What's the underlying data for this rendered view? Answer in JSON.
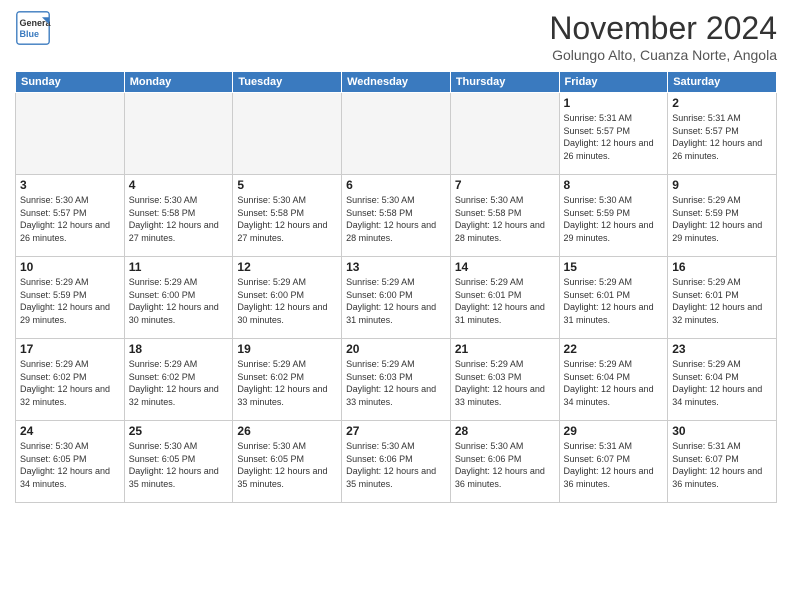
{
  "header": {
    "logo_general": "General",
    "logo_blue": "Blue",
    "month_title": "November 2024",
    "location": "Golungo Alto, Cuanza Norte, Angola"
  },
  "weekdays": [
    "Sunday",
    "Monday",
    "Tuesday",
    "Wednesday",
    "Thursday",
    "Friday",
    "Saturday"
  ],
  "weeks": [
    [
      {
        "day": "",
        "empty": true
      },
      {
        "day": "",
        "empty": true
      },
      {
        "day": "",
        "empty": true
      },
      {
        "day": "",
        "empty": true
      },
      {
        "day": "",
        "empty": true
      },
      {
        "day": "1",
        "info": "Sunrise: 5:31 AM\nSunset: 5:57 PM\nDaylight: 12 hours\nand 26 minutes."
      },
      {
        "day": "2",
        "info": "Sunrise: 5:31 AM\nSunset: 5:57 PM\nDaylight: 12 hours\nand 26 minutes."
      }
    ],
    [
      {
        "day": "3",
        "info": "Sunrise: 5:30 AM\nSunset: 5:57 PM\nDaylight: 12 hours\nand 26 minutes."
      },
      {
        "day": "4",
        "info": "Sunrise: 5:30 AM\nSunset: 5:58 PM\nDaylight: 12 hours\nand 27 minutes."
      },
      {
        "day": "5",
        "info": "Sunrise: 5:30 AM\nSunset: 5:58 PM\nDaylight: 12 hours\nand 27 minutes."
      },
      {
        "day": "6",
        "info": "Sunrise: 5:30 AM\nSunset: 5:58 PM\nDaylight: 12 hours\nand 28 minutes."
      },
      {
        "day": "7",
        "info": "Sunrise: 5:30 AM\nSunset: 5:58 PM\nDaylight: 12 hours\nand 28 minutes."
      },
      {
        "day": "8",
        "info": "Sunrise: 5:30 AM\nSunset: 5:59 PM\nDaylight: 12 hours\nand 29 minutes."
      },
      {
        "day": "9",
        "info": "Sunrise: 5:29 AM\nSunset: 5:59 PM\nDaylight: 12 hours\nand 29 minutes."
      }
    ],
    [
      {
        "day": "10",
        "info": "Sunrise: 5:29 AM\nSunset: 5:59 PM\nDaylight: 12 hours\nand 29 minutes."
      },
      {
        "day": "11",
        "info": "Sunrise: 5:29 AM\nSunset: 6:00 PM\nDaylight: 12 hours\nand 30 minutes."
      },
      {
        "day": "12",
        "info": "Sunrise: 5:29 AM\nSunset: 6:00 PM\nDaylight: 12 hours\nand 30 minutes."
      },
      {
        "day": "13",
        "info": "Sunrise: 5:29 AM\nSunset: 6:00 PM\nDaylight: 12 hours\nand 31 minutes."
      },
      {
        "day": "14",
        "info": "Sunrise: 5:29 AM\nSunset: 6:01 PM\nDaylight: 12 hours\nand 31 minutes."
      },
      {
        "day": "15",
        "info": "Sunrise: 5:29 AM\nSunset: 6:01 PM\nDaylight: 12 hours\nand 31 minutes."
      },
      {
        "day": "16",
        "info": "Sunrise: 5:29 AM\nSunset: 6:01 PM\nDaylight: 12 hours\nand 32 minutes."
      }
    ],
    [
      {
        "day": "17",
        "info": "Sunrise: 5:29 AM\nSunset: 6:02 PM\nDaylight: 12 hours\nand 32 minutes."
      },
      {
        "day": "18",
        "info": "Sunrise: 5:29 AM\nSunset: 6:02 PM\nDaylight: 12 hours\nand 32 minutes."
      },
      {
        "day": "19",
        "info": "Sunrise: 5:29 AM\nSunset: 6:02 PM\nDaylight: 12 hours\nand 33 minutes."
      },
      {
        "day": "20",
        "info": "Sunrise: 5:29 AM\nSunset: 6:03 PM\nDaylight: 12 hours\nand 33 minutes."
      },
      {
        "day": "21",
        "info": "Sunrise: 5:29 AM\nSunset: 6:03 PM\nDaylight: 12 hours\nand 33 minutes."
      },
      {
        "day": "22",
        "info": "Sunrise: 5:29 AM\nSunset: 6:04 PM\nDaylight: 12 hours\nand 34 minutes."
      },
      {
        "day": "23",
        "info": "Sunrise: 5:29 AM\nSunset: 6:04 PM\nDaylight: 12 hours\nand 34 minutes."
      }
    ],
    [
      {
        "day": "24",
        "info": "Sunrise: 5:30 AM\nSunset: 6:05 PM\nDaylight: 12 hours\nand 34 minutes."
      },
      {
        "day": "25",
        "info": "Sunrise: 5:30 AM\nSunset: 6:05 PM\nDaylight: 12 hours\nand 35 minutes."
      },
      {
        "day": "26",
        "info": "Sunrise: 5:30 AM\nSunset: 6:05 PM\nDaylight: 12 hours\nand 35 minutes."
      },
      {
        "day": "27",
        "info": "Sunrise: 5:30 AM\nSunset: 6:06 PM\nDaylight: 12 hours\nand 35 minutes."
      },
      {
        "day": "28",
        "info": "Sunrise: 5:30 AM\nSunset: 6:06 PM\nDaylight: 12 hours\nand 36 minutes."
      },
      {
        "day": "29",
        "info": "Sunrise: 5:31 AM\nSunset: 6:07 PM\nDaylight: 12 hours\nand 36 minutes."
      },
      {
        "day": "30",
        "info": "Sunrise: 5:31 AM\nSunset: 6:07 PM\nDaylight: 12 hours\nand 36 minutes."
      }
    ]
  ]
}
